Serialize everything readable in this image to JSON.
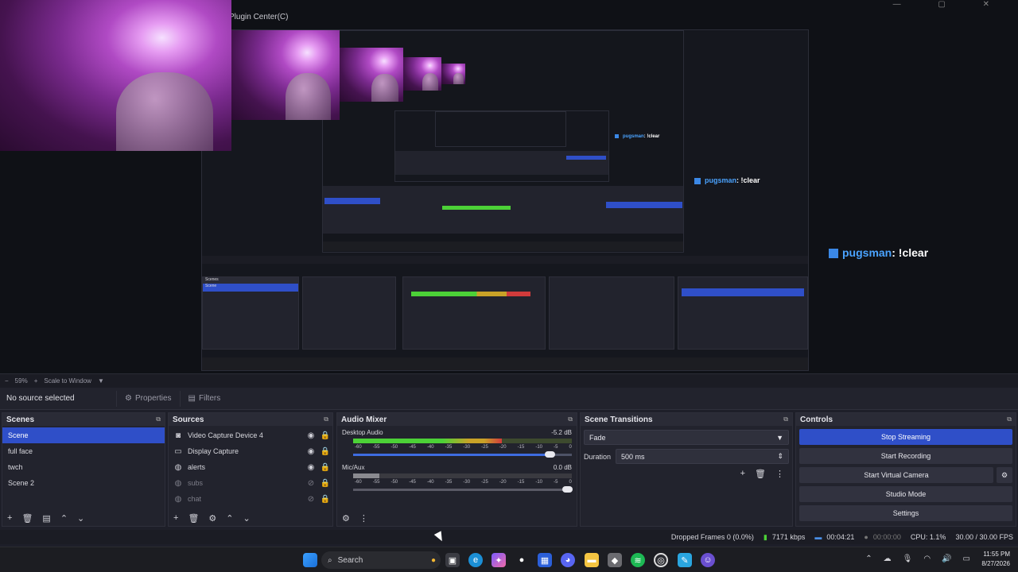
{
  "window": {
    "caption": "Plugin Center(C)"
  },
  "preview": {
    "chat": {
      "user": "pugsman",
      "message": ": !clear"
    },
    "zoom_text": "59%",
    "scale_mode": "Scale to Window"
  },
  "source_bar": {
    "label": "No source selected",
    "properties": "Properties",
    "filters": "Filters"
  },
  "scenes": {
    "title": "Scenes",
    "items": [
      "Scene",
      "full face",
      "twch",
      "Scene 2"
    ],
    "selected": 0
  },
  "sources": {
    "title": "Sources",
    "items": [
      {
        "name": "Video Capture Device 4",
        "icon": "camera-icon",
        "visible": true
      },
      {
        "name": "Display Capture",
        "icon": "monitor-icon",
        "visible": true
      },
      {
        "name": "alerts",
        "icon": "browser-icon",
        "visible": true
      },
      {
        "name": "subs",
        "icon": "browser-icon",
        "visible": false
      },
      {
        "name": "chat",
        "icon": "browser-icon",
        "visible": false
      }
    ]
  },
  "mixer": {
    "title": "Audio Mixer",
    "scale": [
      "-60",
      "-55",
      "-50",
      "-45",
      "-40",
      "-35",
      "-30",
      "-25",
      "-20",
      "-15",
      "-10",
      "-5",
      "0"
    ],
    "channels": [
      {
        "name": "Desktop Audio",
        "db": "-5.2 dB",
        "level": 0.68,
        "volume": 0.9
      },
      {
        "name": "Mic/Aux",
        "db": "0.0 dB",
        "level": 0.12,
        "volume": 0.98
      }
    ]
  },
  "transitions": {
    "title": "Scene Transitions",
    "type": "Fade",
    "duration_label": "Duration",
    "duration_value": "500 ms"
  },
  "controls": {
    "title": "Controls",
    "buttons": [
      "Stop Streaming",
      "Start Recording",
      "Start Virtual Camera",
      "Studio Mode",
      "Settings"
    ]
  },
  "status": {
    "dropped": "Dropped Frames 0 (0.0%)",
    "bitrate": "7171 kbps",
    "live_time": "00:04:21",
    "rec_time": "00:00:00",
    "cpu": "CPU: 1.1%",
    "fps": "30.00 / 30.00 FPS"
  },
  "taskbar": {
    "search": "Search",
    "time": "11:55 PM",
    "date": "8/27/2026"
  },
  "colors": {
    "accent": "#2f4fc8",
    "chat_user": "#4aa3ff",
    "dock_bg": "#22232d"
  }
}
